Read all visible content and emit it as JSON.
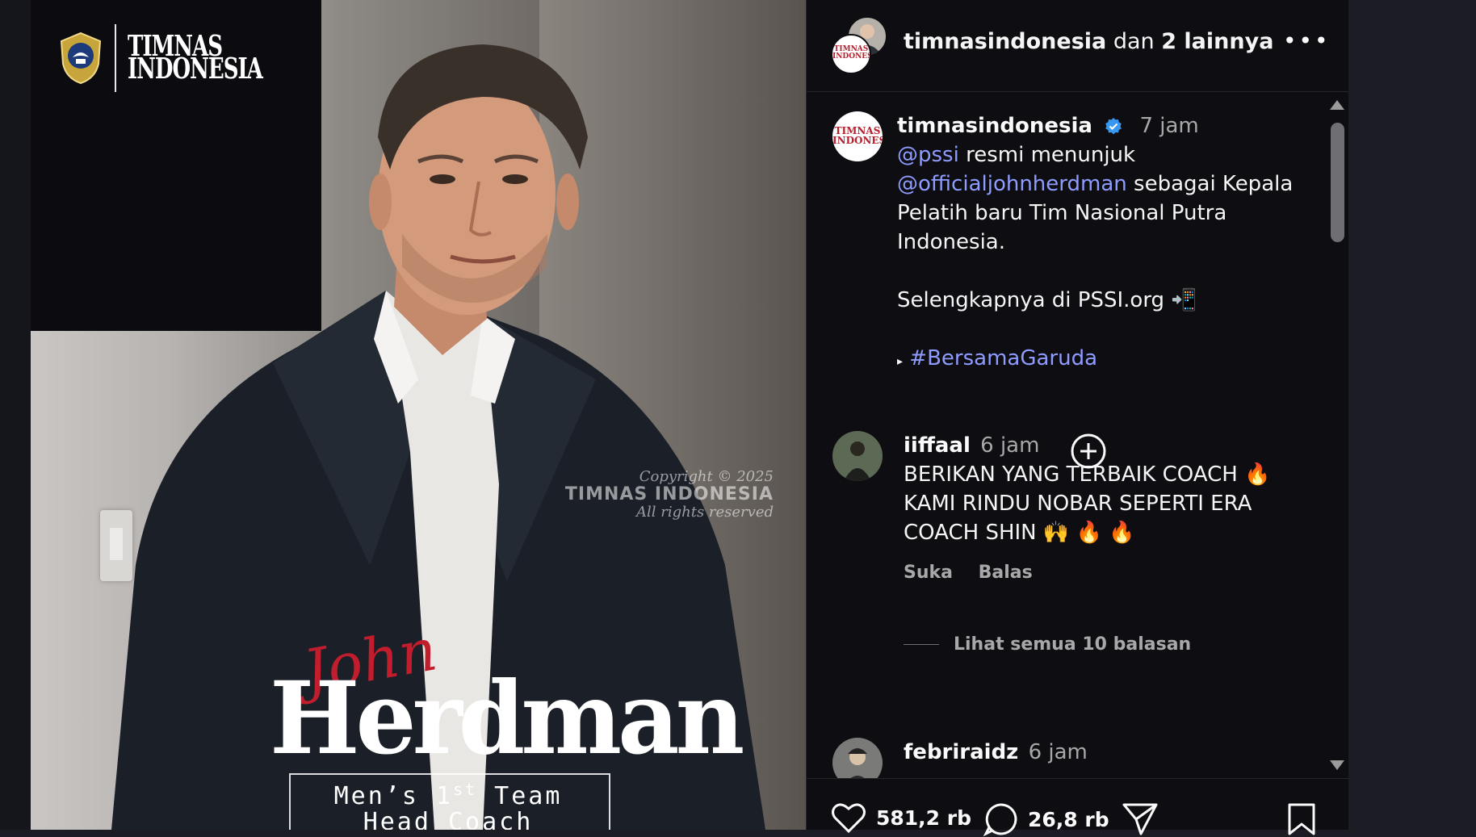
{
  "image": {
    "logo_text_line1": "TIMNAS",
    "logo_text_line2": "INDONESIA",
    "watermark_line1": "Copyright © 2025",
    "watermark_line2": "TIMNAS INDONESIA",
    "watermark_line3": "All rights reserved",
    "first_name": "John",
    "surname": "Herdman",
    "role_line1_prefix": "Men’s 1",
    "role_line1_sup": "st",
    "role_line1_suffix": " Team",
    "role_line2": "Head Coach"
  },
  "header": {
    "account": "timnasindonesia",
    "connector": "dan",
    "others": "2 lainnya",
    "more_icon": "more-horizontal-icon"
  },
  "post": {
    "username": "timnasindonesia",
    "time": "7 jam",
    "mention1": "@pssi",
    "text1": " resmi menunjuk",
    "mention2": "@officialjohnherdman",
    "text2": " sebagai Kepala Pelatih baru Tim Nasional Putra Indonesia.",
    "text3": "Selengkapnya di PSSI.org",
    "bullet": "▸",
    "hashtag": "#BersamaGaruda"
  },
  "comments": [
    {
      "username": "iiffaal",
      "time": "6 jam",
      "text": "BERIKAN YANG TERBAIK COACH 🔥 KAMI RINDU NOBAR SEPERTI ERA COACH SHIN 🙌 🔥 🔥",
      "like": "Suka",
      "reply": "Balas",
      "view_replies": "Lihat semua 10 balasan"
    },
    {
      "username": "febriraidz",
      "time": "6 jam"
    }
  ],
  "footer": {
    "likes": "581,2 rb",
    "comments": "26,8 rb"
  },
  "colors": {
    "accent_link": "#8f9cff",
    "verified": "#3897f0",
    "panel_bg": "#0e0e12",
    "brand_red": "#c11d2d"
  }
}
